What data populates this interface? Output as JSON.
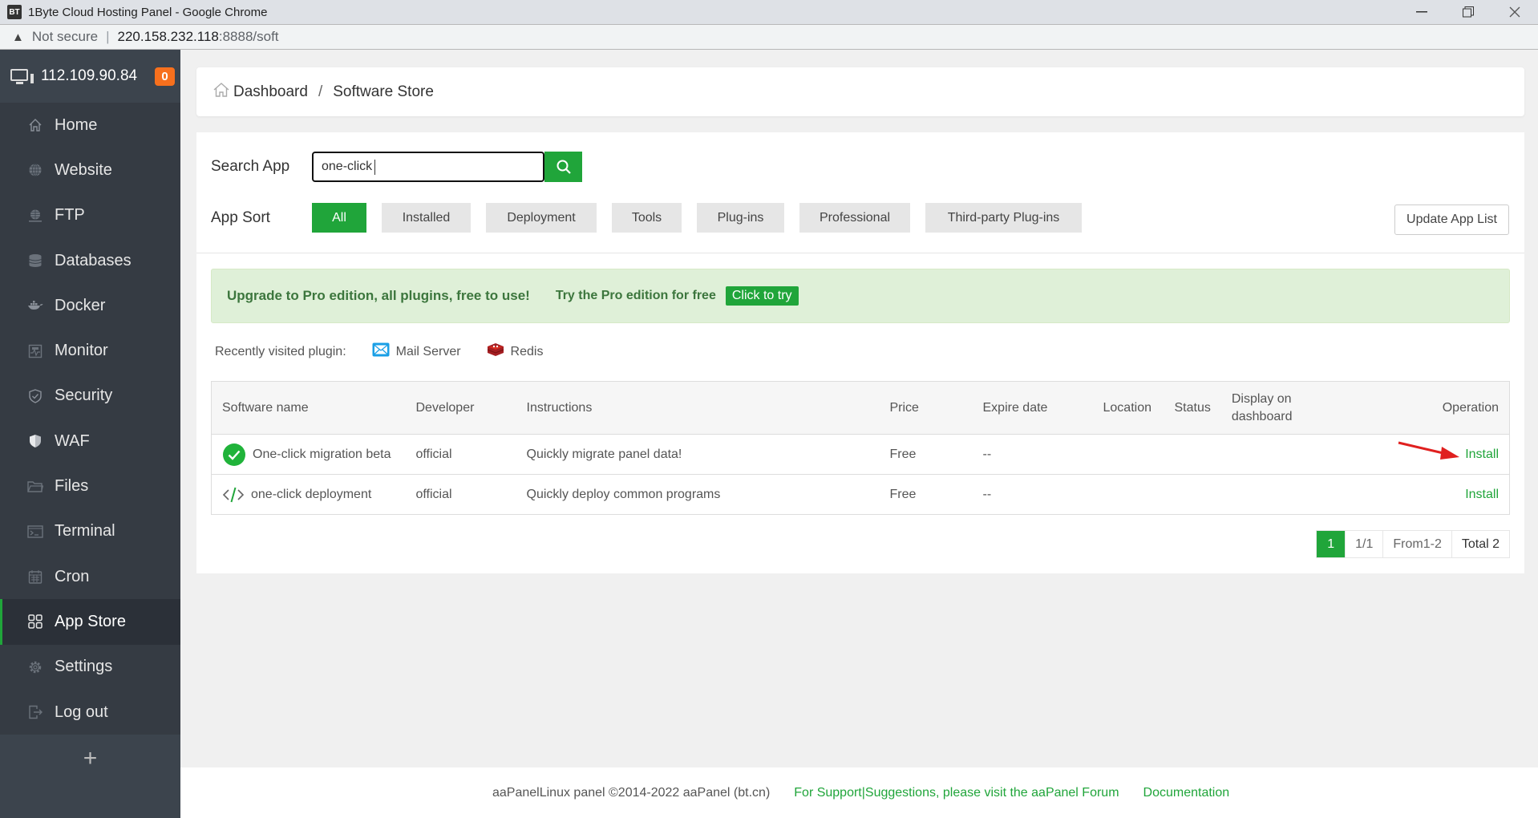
{
  "browser": {
    "app_icon_text": "BT",
    "window_title": "1Byte Cloud Hosting Panel - Google Chrome",
    "security_label": "Not secure",
    "url_host": "220.158.232.118",
    "url_rest": ":8888/soft"
  },
  "sidebar": {
    "server_ip": "112.109.90.84",
    "notification_count": "0",
    "items": [
      {
        "label": "Home",
        "icon": "home-icon"
      },
      {
        "label": "Website",
        "icon": "globe-icon"
      },
      {
        "label": "FTP",
        "icon": "ftp-icon"
      },
      {
        "label": "Databases",
        "icon": "database-icon"
      },
      {
        "label": "Docker",
        "icon": "docker-icon"
      },
      {
        "label": "Monitor",
        "icon": "monitor-icon"
      },
      {
        "label": "Security",
        "icon": "shield-icon"
      },
      {
        "label": "WAF",
        "icon": "waf-shield-icon"
      },
      {
        "label": "Files",
        "icon": "folder-icon"
      },
      {
        "label": "Terminal",
        "icon": "terminal-icon"
      },
      {
        "label": "Cron",
        "icon": "calendar-icon"
      },
      {
        "label": "App Store",
        "icon": "apps-grid-icon",
        "active": true
      },
      {
        "label": "Settings",
        "icon": "gear-icon"
      },
      {
        "label": "Log out",
        "icon": "logout-icon"
      }
    ],
    "add_label": "+"
  },
  "breadcrumb": {
    "home": "Dashboard",
    "separator": "/",
    "current": "Software Store"
  },
  "search": {
    "label": "Search App",
    "value": "one-click"
  },
  "sort": {
    "label": "App Sort",
    "options": [
      "All",
      "Installed",
      "Deployment",
      "Tools",
      "Plug-ins",
      "Professional",
      "Third-party Plug-ins"
    ],
    "selected": "All",
    "update_button": "Update App List"
  },
  "promo": {
    "headline": "Upgrade to Pro edition, all plugins, free to use!",
    "subtext": "Try the Pro edition for free",
    "button": "Click to try"
  },
  "recent": {
    "label": "Recently visited plugin:",
    "plugins": [
      "Mail Server",
      "Redis"
    ]
  },
  "table": {
    "headers": [
      "Software name",
      "Developer",
      "Instructions",
      "Price",
      "Expire date",
      "Location",
      "Status",
      "Display on dashboard",
      "Operation"
    ],
    "rows": [
      {
        "name": "One-click migration beta",
        "developer": "official",
        "instructions": "Quickly migrate panel data!",
        "price": "Free",
        "expire": "--",
        "location": "",
        "status": "",
        "display": "",
        "operation": "Install"
      },
      {
        "name": "one-click deployment",
        "developer": "official",
        "instructions": "Quickly deploy common programs",
        "price": "Free",
        "expire": "--",
        "location": "",
        "status": "",
        "display": "",
        "operation": "Install"
      }
    ]
  },
  "pagination": {
    "current": "1",
    "pages": "1/1",
    "range": "From1-2",
    "total": "Total 2"
  },
  "footer": {
    "copyright": "aaPanelLinux panel ©2014-2022 aaPanel (bt.cn)",
    "support_link": "For Support|Suggestions, please visit the aaPanel Forum",
    "docs_link": "Documentation"
  },
  "colors": {
    "accent": "#20a53a",
    "sidebar_bg": "#3c444d",
    "badge": "#f7701d",
    "promo_bg": "#dff0d8",
    "annotation_arrow": "#e0201f"
  }
}
